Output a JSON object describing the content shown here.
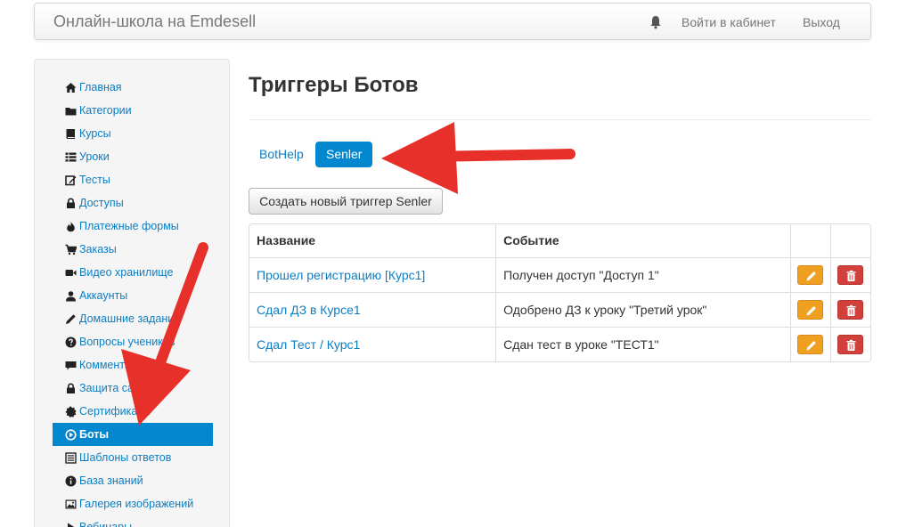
{
  "navbar": {
    "brand": "Онлайн-школа на Emdesell",
    "bell_icon": "bell-icon",
    "login_label": "Войти в кабинет",
    "logout_label": "Выход"
  },
  "sidebar": {
    "items": [
      {
        "label": "Главная",
        "icon": "home-icon"
      },
      {
        "label": "Категории",
        "icon": "folder-icon"
      },
      {
        "label": "Курсы",
        "icon": "book-icon"
      },
      {
        "label": "Уроки",
        "icon": "list-icon"
      },
      {
        "label": "Тесты",
        "icon": "edit-icon"
      },
      {
        "label": "Доступы",
        "icon": "lock-icon"
      },
      {
        "label": "Платежные формы",
        "icon": "fire-icon"
      },
      {
        "label": "Заказы",
        "icon": "cart-icon"
      },
      {
        "label": "Видео хранилище",
        "icon": "video-icon"
      },
      {
        "label": "Аккаунты",
        "icon": "user-icon"
      },
      {
        "label": "Домашние задания",
        "icon": "pencil-icon"
      },
      {
        "label": "Вопросы учеников",
        "icon": "question-icon"
      },
      {
        "label": "Комментарии",
        "icon": "comment-icon"
      },
      {
        "label": "Защита сайта",
        "icon": "lock-icon"
      },
      {
        "label": "Сертификаты",
        "icon": "certificate-icon"
      },
      {
        "label": "Боты",
        "icon": "play-circle-icon",
        "active": true
      },
      {
        "label": "Шаблоны ответов",
        "icon": "template-icon"
      },
      {
        "label": "База знаний",
        "icon": "info-icon"
      },
      {
        "label": "Галерея изображений",
        "icon": "picture-icon"
      },
      {
        "label": "Вебинары",
        "icon": "play-icon"
      }
    ]
  },
  "main": {
    "title": "Триггеры Ботов",
    "tabs": [
      {
        "label": "BotHelp",
        "active": false
      },
      {
        "label": "Senler",
        "active": true
      }
    ],
    "create_button_label": "Создать новый триггер Senler",
    "table": {
      "headers": [
        "Название",
        "Событие",
        "",
        ""
      ],
      "rows": [
        {
          "name": "Прошел регистрацию [Курс1]",
          "event": "Получен доступ \"Доступ 1\""
        },
        {
          "name": "Сдал ДЗ в Курсе1",
          "event": "Одобрено ДЗ к уроку \"Третий урок\""
        },
        {
          "name": "Сдал Тест / Курс1",
          "event": "Сдан тест в уроке \"ТЕСТ1\""
        }
      ],
      "edit_icon": "pencil-icon",
      "delete_icon": "trash-icon"
    }
  },
  "colors": {
    "link": "#0b7ec4",
    "active_bg": "#0388cf",
    "edit_button": "#f0a020",
    "delete_button": "#d2403b",
    "annotation_arrow": "#e8302b"
  }
}
